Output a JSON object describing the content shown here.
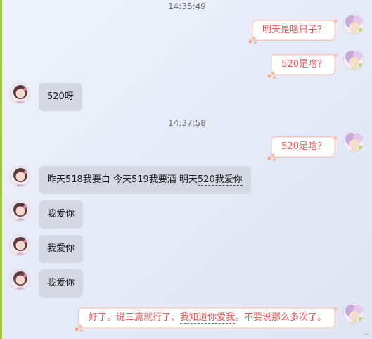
{
  "timestamps": [
    "14:35:49",
    "14:37:58"
  ],
  "messages": [
    {
      "side": "out",
      "text": "明天是啥日子？"
    },
    {
      "side": "out",
      "text": "520是啥？"
    },
    {
      "side": "in",
      "text": "520呀"
    },
    {
      "side": "out",
      "text": "520是啥？"
    },
    {
      "side": "in",
      "text_a": "昨天518我要白 今天519我要酒 明天",
      "text_b": "520我爱你"
    },
    {
      "side": "in",
      "text": "我爱你"
    },
    {
      "side": "in",
      "text": "我爱你"
    },
    {
      "side": "in",
      "text": "我爱你"
    },
    {
      "side": "out",
      "text_a": "好了。说三篇就行了、",
      "text_b": "我知道你爱我",
      "text_c": "。不要说那么多次了。"
    }
  ],
  "colors": {
    "incoming_bubble": "#d5d8e2",
    "outgoing_text": "#ee5a5a",
    "left_accent": "#a6c94a"
  }
}
